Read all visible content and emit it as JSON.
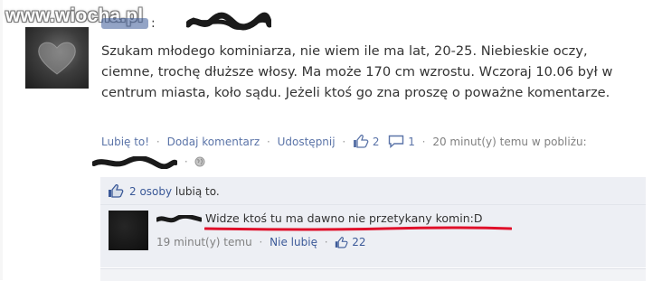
{
  "watermark": "www.wiocha.pl",
  "post": {
    "author_suffix": ":",
    "text": "Szukam młodego kominiarza, nie wiem ile ma lat, 20-25. Niebieskie oczy, ciemne, trochę dłuższe włosy. Ma może 170 cm wzrostu. Wczoraj 10.06 był w centrum miasta, koło sądu. Jeżeli ktoś go zna proszę o poważne komentarze.",
    "actions": {
      "like": "Lubię to!",
      "comment": "Dodaj komentarz",
      "share": "Udostępnij",
      "like_count": "2",
      "comment_count": "1",
      "timestamp": "20 minut(y) temu w pobliżu:"
    }
  },
  "likes_summary": {
    "count_text": "2 osoby",
    "suffix": " lubią to."
  },
  "comment": {
    "text": "Widze ktoś tu ma dawno nie przetykany komin:D",
    "time": "19 minut(y) temu",
    "unlike": "Nie lubię",
    "like_count": "22"
  },
  "colors": {
    "link": "#3b5998",
    "muted_link": "#5b74a8",
    "comment_bg": "#edeff4",
    "highlight_underline": "#e0102a"
  },
  "icons": [
    "thumbs-up-icon",
    "speech-bubble-icon",
    "globe-icon",
    "heart-icon"
  ]
}
